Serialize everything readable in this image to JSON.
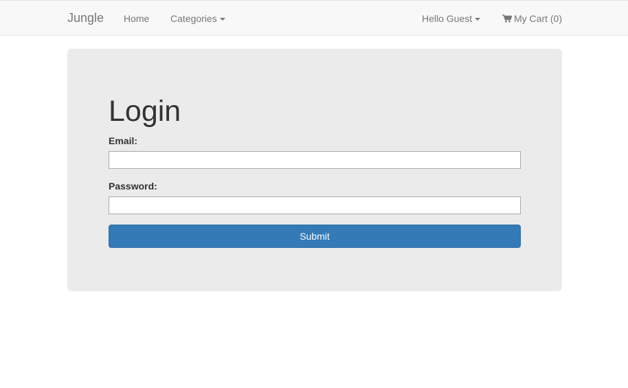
{
  "navbar": {
    "brand": "Jungle",
    "home_label": "Home",
    "categories_label": "Categories",
    "user_menu_label": "Hello Guest",
    "cart_label": "My Cart (0)",
    "icons": {
      "categories_caret": "caret-down-icon",
      "user_caret": "caret-down-icon",
      "cart": "shopping-cart-icon"
    }
  },
  "login": {
    "title": "Login",
    "email_label": "Email:",
    "email_value": "",
    "password_label": "Password:",
    "password_value": "",
    "submit_label": "Submit"
  },
  "colors": {
    "navbar_bg": "#f8f8f8",
    "panel_bg": "#ebebeb",
    "primary_button": "#337ab7",
    "nav_text": "#777777"
  }
}
